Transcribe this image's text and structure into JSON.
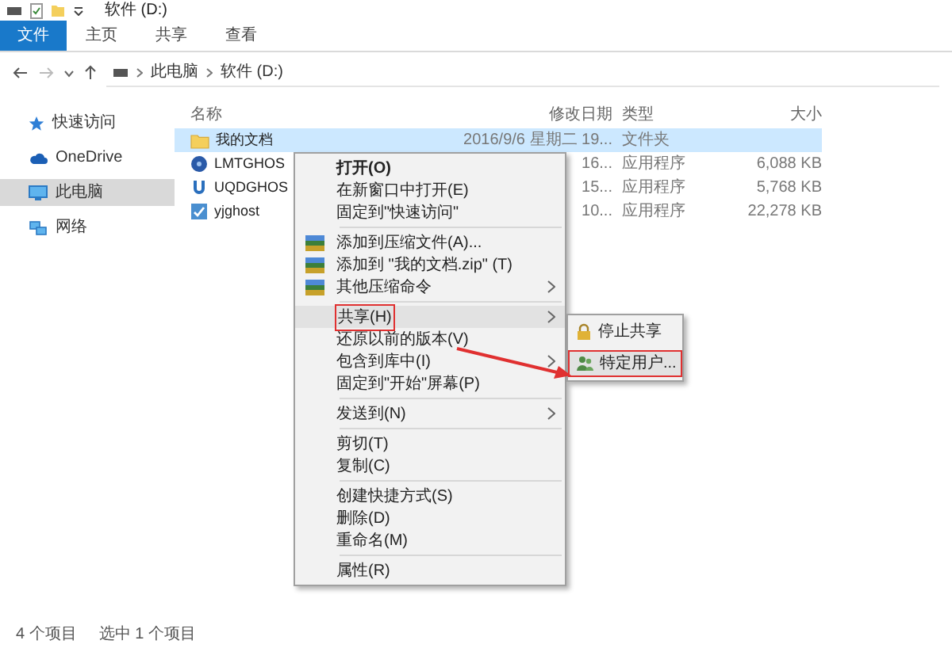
{
  "window": {
    "title": "软件 (D:)"
  },
  "ribbon_tabs": [
    {
      "label": "文件",
      "kind": "file"
    },
    {
      "label": "主页",
      "kind": "tab"
    },
    {
      "label": "共享",
      "kind": "tab"
    },
    {
      "label": "查看",
      "kind": "tab"
    }
  ],
  "address": {
    "path": [
      "此电脑",
      "软件 (D:)"
    ]
  },
  "nav": [
    {
      "label": "快速访问",
      "kind": "star",
      "selected": false
    },
    {
      "label": "OneDrive",
      "kind": "cloud",
      "selected": false
    },
    {
      "label": "此电脑",
      "kind": "pc",
      "selected": true
    },
    {
      "label": "网络",
      "kind": "network",
      "selected": false
    }
  ],
  "columns": [
    "名称",
    "修改日期",
    "类型",
    "大小"
  ],
  "rows": [
    {
      "name": "我的文档",
      "date": "2016/9/6 星期二 19...",
      "type": "文件夹",
      "kind": "folder",
      "selected": true
    },
    {
      "name": "LMTGHOS",
      "date": "16...",
      "type": "应用程序",
      "size": "6,088 KB",
      "kind": "disk",
      "selected": false
    },
    {
      "name": "UQDGHOS",
      "date": "15...",
      "type": "应用程序",
      "size": "5,768 KB",
      "kind": "u",
      "selected": false
    },
    {
      "name": "yjghost",
      "date": "10...",
      "type": "应用程序",
      "size": "22,278 KB",
      "kind": "app",
      "selected": false
    }
  ],
  "context_menu": [
    [
      {
        "label": "打开(O)",
        "kind": "text",
        "bold": true
      },
      {
        "label": "在新窗口中打开(E)",
        "kind": "text"
      },
      {
        "label": "固定到\"快速访问\"",
        "kind": "text"
      }
    ],
    [
      {
        "label": "添加到压缩文件(A)...",
        "kind": "archive"
      },
      {
        "label": "添加到 \"我的文档.zip\" (T)",
        "kind": "archive"
      },
      {
        "label": "其他压缩命令",
        "kind": "archive",
        "submenu": true
      }
    ],
    [
      {
        "label": "共享(H)",
        "kind": "text",
        "submenu": true,
        "selected": true
      },
      {
        "label": "还原以前的版本(V)",
        "kind": "text"
      },
      {
        "label": "包含到库中(I)",
        "kind": "text",
        "submenu": true
      },
      {
        "label": "固定到\"开始\"屏幕(P)",
        "kind": "text"
      }
    ],
    [
      {
        "label": "发送到(N)",
        "kind": "text",
        "submenu": true
      }
    ],
    [
      {
        "label": "剪切(T)",
        "kind": "text"
      },
      {
        "label": "复制(C)",
        "kind": "text"
      }
    ],
    [
      {
        "label": "创建快捷方式(S)",
        "kind": "text"
      },
      {
        "label": "删除(D)",
        "kind": "text"
      },
      {
        "label": "重命名(M)",
        "kind": "text"
      }
    ],
    [
      {
        "label": "属性(R)",
        "kind": "text"
      }
    ]
  ],
  "share_submenu": [
    {
      "label": "停止共享",
      "kind": "lock",
      "selected": false
    },
    {
      "label": "特定用户...",
      "kind": "users",
      "selected": true
    }
  ],
  "status_bar": [
    "4 个项目",
    "选中 1 个项目"
  ]
}
